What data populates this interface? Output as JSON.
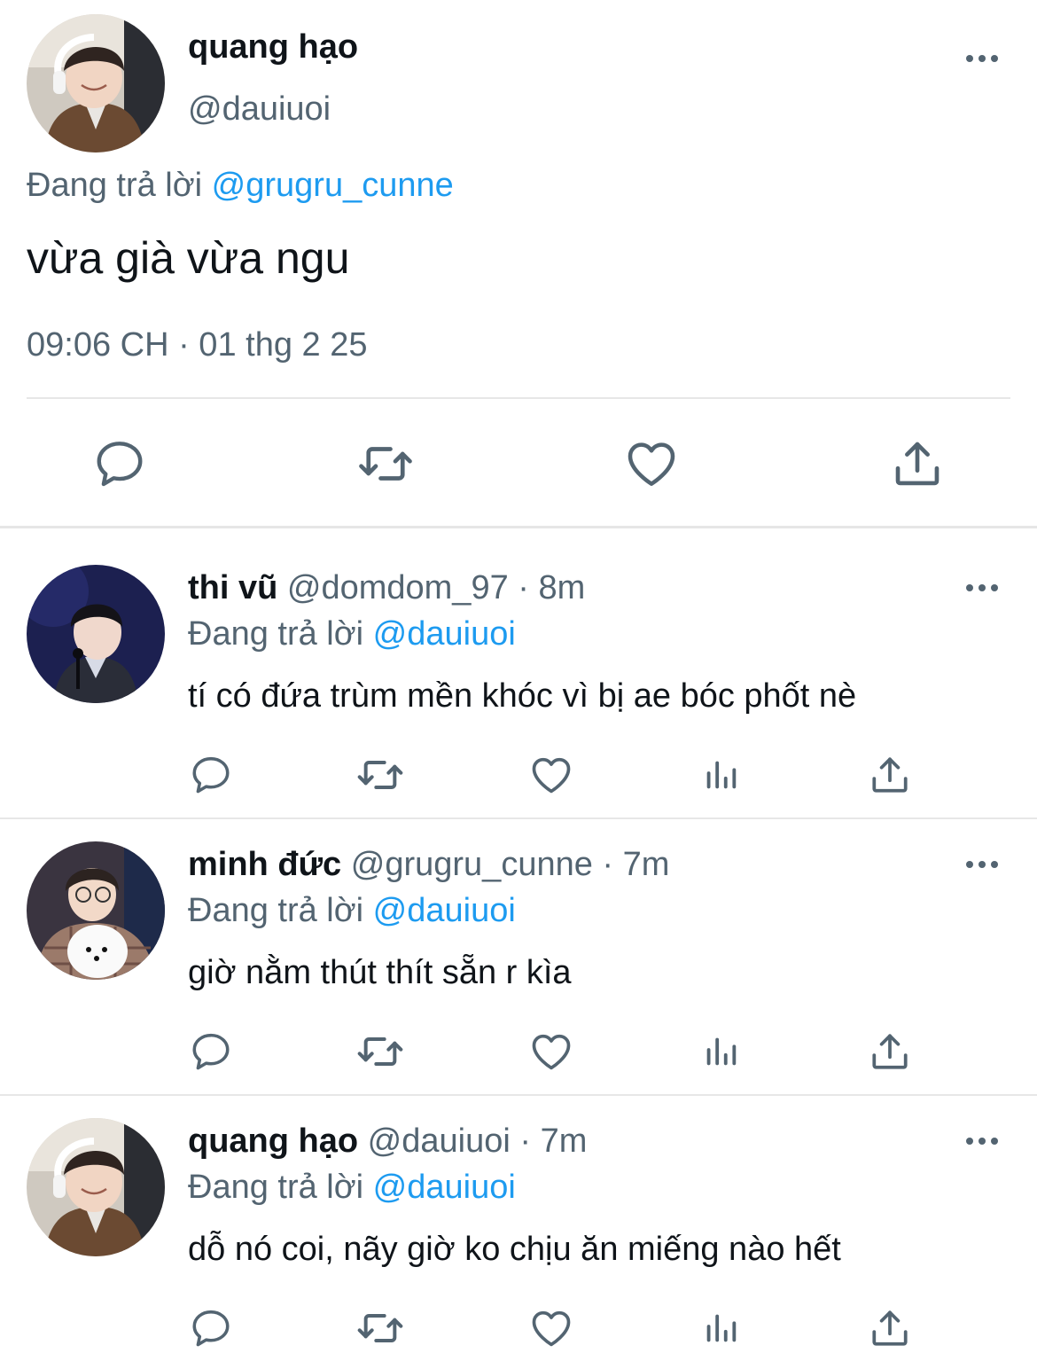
{
  "main_tweet": {
    "display_name": "quang hạo",
    "handle": "@dauiuoi",
    "reply_prefix": "Đang trả lời",
    "reply_to": "@grugru_cunne",
    "text": "vừa già vừa ngu",
    "timestamp": "09:06 CH · 01 thg 2 25",
    "actions": [
      "reply-icon",
      "retweet-icon",
      "like-icon",
      "share-icon"
    ]
  },
  "replies": [
    {
      "display_name": "thi vũ",
      "handle": "@domdom_97",
      "time": "· 8m",
      "reply_prefix": "Đang trả lời",
      "reply_to": "@dauiuoi",
      "text": "tí có đứa trùm mền khóc vì bị ae bóc phốt nè"
    },
    {
      "display_name": "minh đức",
      "handle": "@grugru_cunne",
      "time": "· 7m",
      "reply_prefix": "Đang trả lời",
      "reply_to": "@dauiuoi",
      "text": "giờ nằm thút thít sẵn r kìa"
    },
    {
      "display_name": "quang hạo",
      "handle": "@dauiuoi",
      "time": "· 7m",
      "reply_prefix": "Đang trả lời",
      "reply_to": "@dauiuoi",
      "text": "dỗ nó coi, nãy giờ ko chịu ăn miếng nào hết"
    }
  ],
  "reply_actions": [
    "reply-icon",
    "retweet-icon",
    "like-icon",
    "analytics-icon",
    "share-icon"
  ],
  "colors": {
    "text": "#0f1419",
    "secondary": "#536471",
    "link": "#1d9bf0",
    "divider": "#e7e7e7"
  }
}
